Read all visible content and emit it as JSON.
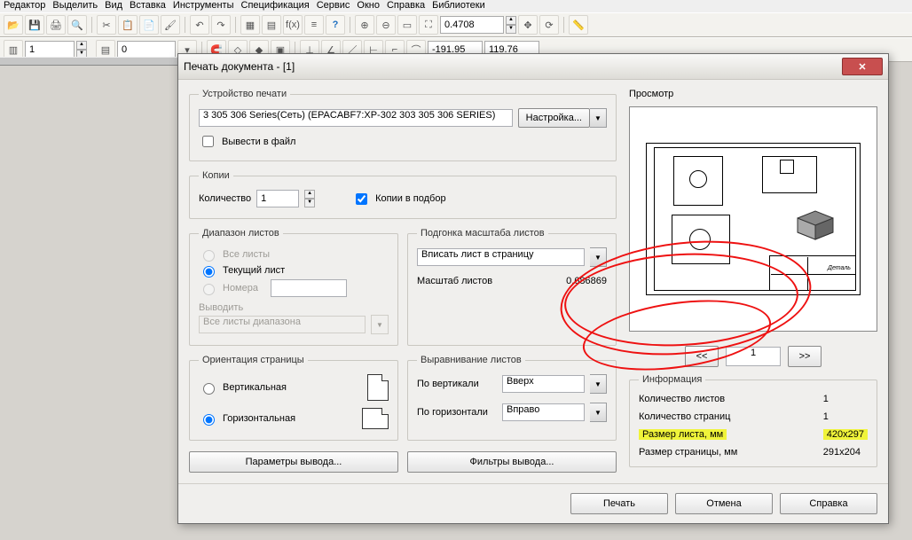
{
  "menu": {
    "items": [
      "Редактор",
      "Выделить",
      "Вид",
      "Вставка",
      "Инструменты",
      "Спецификация",
      "Сервис",
      "Окно",
      "Справка",
      "Библиотеки"
    ]
  },
  "toolbar2": {
    "zoom": "0.4708",
    "coord_x": "-191.95",
    "coord_y": "119.76",
    "f1": "1",
    "f2": "0"
  },
  "dialog": {
    "title": "Печать документа - [1]",
    "device": {
      "legend": "Устройство печати",
      "printer": "3 305 306 Series(Сеть) (EPACABF7:XP-302 303 305 306 SERIES)",
      "config_btn": "Настройка...",
      "to_file": "Вывести в файл"
    },
    "copies": {
      "legend": "Копии",
      "qty_label": "Количество",
      "qty": "1",
      "collate": "Копии в подбор"
    },
    "range": {
      "legend": "Диапазон листов",
      "all": "Все листы",
      "current": "Текущий лист",
      "numbers": "Номера",
      "output_label": "Выводить",
      "output_value": "Все листы диапазона"
    },
    "fit": {
      "legend": "Подгонка масштаба листов",
      "mode": "Вписать лист в страницу",
      "scale_label": "Масштаб листов",
      "scale": "0.686869"
    },
    "orient": {
      "legend": "Ориентация страницы",
      "v": "Вертикальная",
      "h": "Горизонтальная"
    },
    "align": {
      "legend": "Выравнивание листов",
      "vlabel": "По вертикали",
      "vval": "Вверх",
      "hlabel": "По горизонтали",
      "hval": "Вправо"
    },
    "params_btn": "Параметры вывода...",
    "filters_btn": "Фильтры вывода...",
    "preview_label": "Просмотр",
    "pager": {
      "prev": "<<",
      "page": "1",
      "next": ">>"
    },
    "info": {
      "legend": "Информация",
      "sheets_label": "Количество листов",
      "sheets": "1",
      "pages_label": "Количество страниц",
      "pages": "1",
      "sheet_size_label": "Размер листа, мм",
      "sheet_size": "420x297",
      "page_size_label": "Размер страницы, мм",
      "page_size": "291x204"
    },
    "footer": {
      "print": "Печать",
      "cancel": "Отмена",
      "help": "Справка"
    }
  }
}
